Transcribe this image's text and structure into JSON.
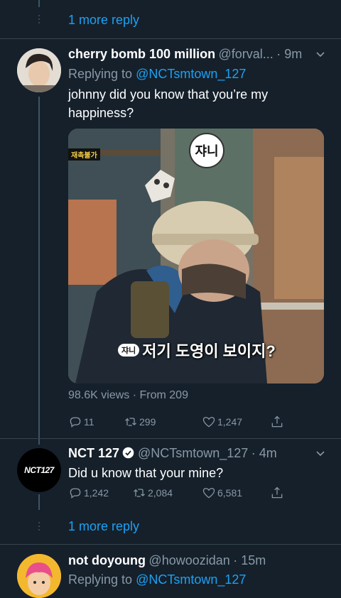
{
  "top_thread": {
    "more_reply": "1 more reply"
  },
  "tweet1": {
    "name": "cherry bomb 100 million",
    "handle": "@forval...",
    "time": "· 9m",
    "replying_prefix": "Replying to",
    "replying_to": "@NCTsmtown_127",
    "text": "johnny did you know that you’re my happiness?",
    "media": {
      "top_sign": "재촉불가",
      "badge": "쟈니",
      "subtitle_tag": "쟈니",
      "subtitle": "저기 도영이 보이지?"
    },
    "views": "98.6K views",
    "source": "· From 209",
    "replies": "11",
    "retweets": "299",
    "likes": "1,247"
  },
  "tweet2": {
    "name": "NCT 127",
    "handle": "@NCTsmtown_127",
    "time": "· 4m",
    "avatar_text": "NCT127",
    "text": "Did u know that your mine?",
    "replies": "1,242",
    "retweets": "2,084",
    "likes": "6,581"
  },
  "middle_thread": {
    "more_reply": "1 more reply"
  },
  "tweet3": {
    "name": "not doyoung",
    "handle": "@howoozidan",
    "time": "· 15m",
    "replying_prefix": "Replying to",
    "replying_to": "@NCTsmtown_127"
  },
  "colors": {
    "background": "#15202b",
    "accent": "#1da1f2",
    "muted": "#8899a6",
    "verified_badge": "#ffffff"
  }
}
